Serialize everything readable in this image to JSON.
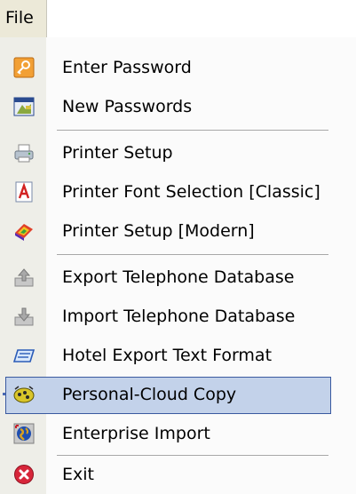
{
  "menubar": {
    "title": "File"
  },
  "menu": {
    "items": [
      {
        "label": "Enter Password",
        "icon": "key-icon"
      },
      {
        "label": "New Passwords",
        "icon": "new-passwords-icon"
      },
      {
        "label": "Printer Setup",
        "icon": "printer-icon"
      },
      {
        "label": "Printer Font Selection [Classic]",
        "icon": "font-icon"
      },
      {
        "label": "Printer Setup [Modern]",
        "icon": "color-wheel-icon"
      },
      {
        "label": "Export Telephone Database",
        "icon": "export-icon"
      },
      {
        "label": "Import Telephone Database",
        "icon": "import-icon"
      },
      {
        "label": "Hotel Export Text Format",
        "icon": "hotel-export-icon"
      },
      {
        "label": "Personal-Cloud Copy",
        "icon": "cloud-copy-icon",
        "selected": true
      },
      {
        "label": "Enterprise Import",
        "icon": "globe-icon"
      },
      {
        "label": "Exit",
        "icon": "exit-icon"
      }
    ]
  },
  "colors": {
    "menu_background": "#fbfbfb",
    "gutter": "#eeeee8",
    "highlight_fill": "#c3d2ea",
    "highlight_border": "#3a5aa0",
    "separator": "#a8a8a8"
  }
}
